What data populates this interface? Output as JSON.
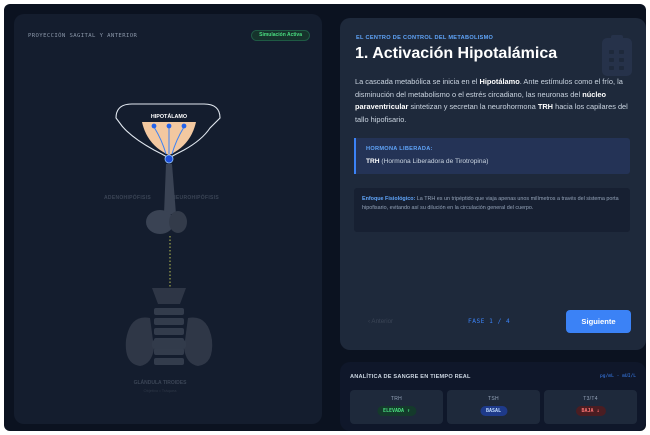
{
  "left_panel": {
    "projection_label": "PROYECCIÓN SAGITAL Y ANTERIOR",
    "sim_badge": "Simulación Activa",
    "hypothalamus_label": "HIPOTÁLAMO",
    "adenohypophysis_label": "ADENOHIPÓFISIS",
    "neurohypophysis_label": "NEUROHIPÓFISIS",
    "thyroid_label": "GLÁNDULA TIROIDES",
    "thyroid_sublabel": "Objetivo • Tráquea"
  },
  "step": {
    "eyebrow": "EL CENTRO DE CONTROL DEL METABOLISMO",
    "title": "1. Activación Hipotalámica",
    "body": {
      "t1": "La cascada metabólica se inicia en el ",
      "b1": "Hipotálamo",
      "t2": ". Ante estímulos como el frío, la disminución del metabolismo o el estrés circadiano, las neuronas del ",
      "b2": "núcleo paraventricular",
      "t3": " sintetizan y secretan la neurohormona ",
      "b3": "TRH",
      "t4": " hacia los capilares del tallo hipofisario."
    },
    "hormone_label": "HORMONA LIBERADA:",
    "hormone_abbr": "TRH",
    "hormone_full": " (Hormona Liberadora de Tirotropina)",
    "note_label": "Enfoque Fisiológico:",
    "note_text": " La TRH es un tripéptido que viaja apenas unos milímetros a través del sistema porta hipofisario, evitando así su dilución en la circulación general del cuerpo.",
    "prev_label": "‹  Anterior",
    "phase_label": "FASE 1 / 4",
    "next_label": "Siguiente"
  },
  "blood": {
    "title": "ANALÍTICA DE SANGRE EN TIEMPO REAL",
    "units": "pg/mL - mUI/L",
    "metrics": [
      {
        "name": "TRH",
        "status": "ELEVADA ↑",
        "tone": "up"
      },
      {
        "name": "TSH",
        "status": "BASAL",
        "tone": "basal"
      },
      {
        "name": "T3/T4",
        "status": "BAJA ↓",
        "tone": "down"
      }
    ]
  },
  "colors": {
    "accent": "#3b82f6",
    "hypothalamus": "#f3c8a0",
    "elevated": "#4ade80",
    "low": "#f87171"
  }
}
